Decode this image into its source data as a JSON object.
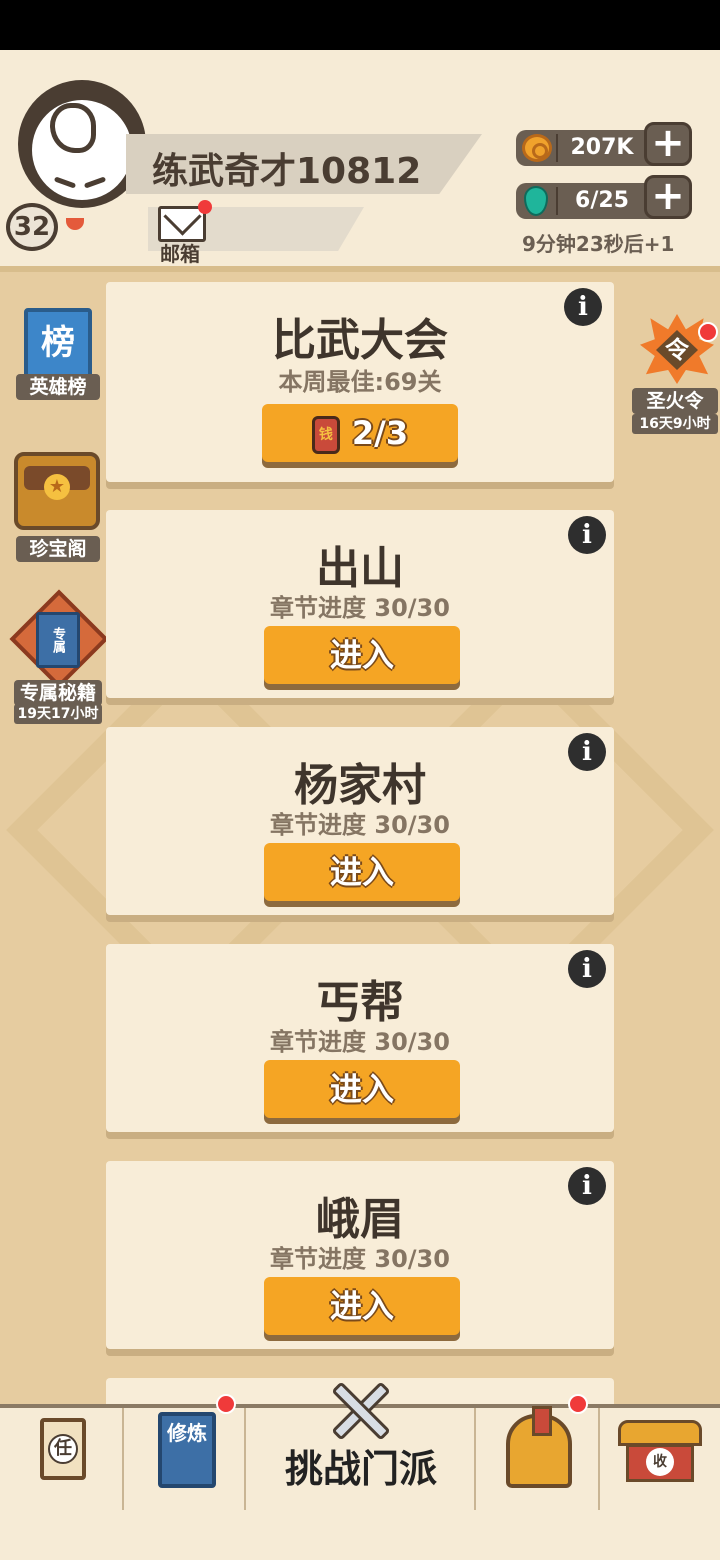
{
  "player": {
    "name": "练武奇才10812",
    "level": "32",
    "mail_label": "邮箱"
  },
  "resources": {
    "coins": "207K",
    "stamina": "6/25",
    "stamina_timer": "9分钟23秒后+1",
    "plus_symbol": "+"
  },
  "side_left": [
    {
      "label": "英雄榜",
      "icon": "榜",
      "sub": ""
    },
    {
      "label": "珍宝阁",
      "icon": "treasure-chest",
      "sub": ""
    },
    {
      "label": "专属秘籍",
      "icon": "专属",
      "sub": "19天17小时"
    }
  ],
  "side_right": {
    "label": "圣火令",
    "icon": "令",
    "sub": "16天9小时"
  },
  "tournament": {
    "title": "比武大会",
    "subtitle": "本周最佳:69关",
    "button": "2/3",
    "token_glyph": "钱"
  },
  "chapters": [
    {
      "title": "出山",
      "progress": "章节进度 30/30",
      "button": "进入"
    },
    {
      "title": "杨家村",
      "progress": "章节进度 30/30",
      "button": "进入"
    },
    {
      "title": "丐帮",
      "progress": "章节进度 30/30",
      "button": "进入"
    },
    {
      "title": "峨眉",
      "progress": "章节进度 30/30",
      "button": "进入"
    }
  ],
  "info_glyph": "i",
  "bottom_nav": {
    "task_glyph": "任",
    "train_glyph": "修炼",
    "challenge_label": "挑战门派",
    "collect_glyph": "收"
  },
  "colors": {
    "accent_orange": "#f5a524",
    "card_bg": "#f8edd8",
    "page_bg": "#e6cca0",
    "notify_red": "#f03a3a"
  }
}
